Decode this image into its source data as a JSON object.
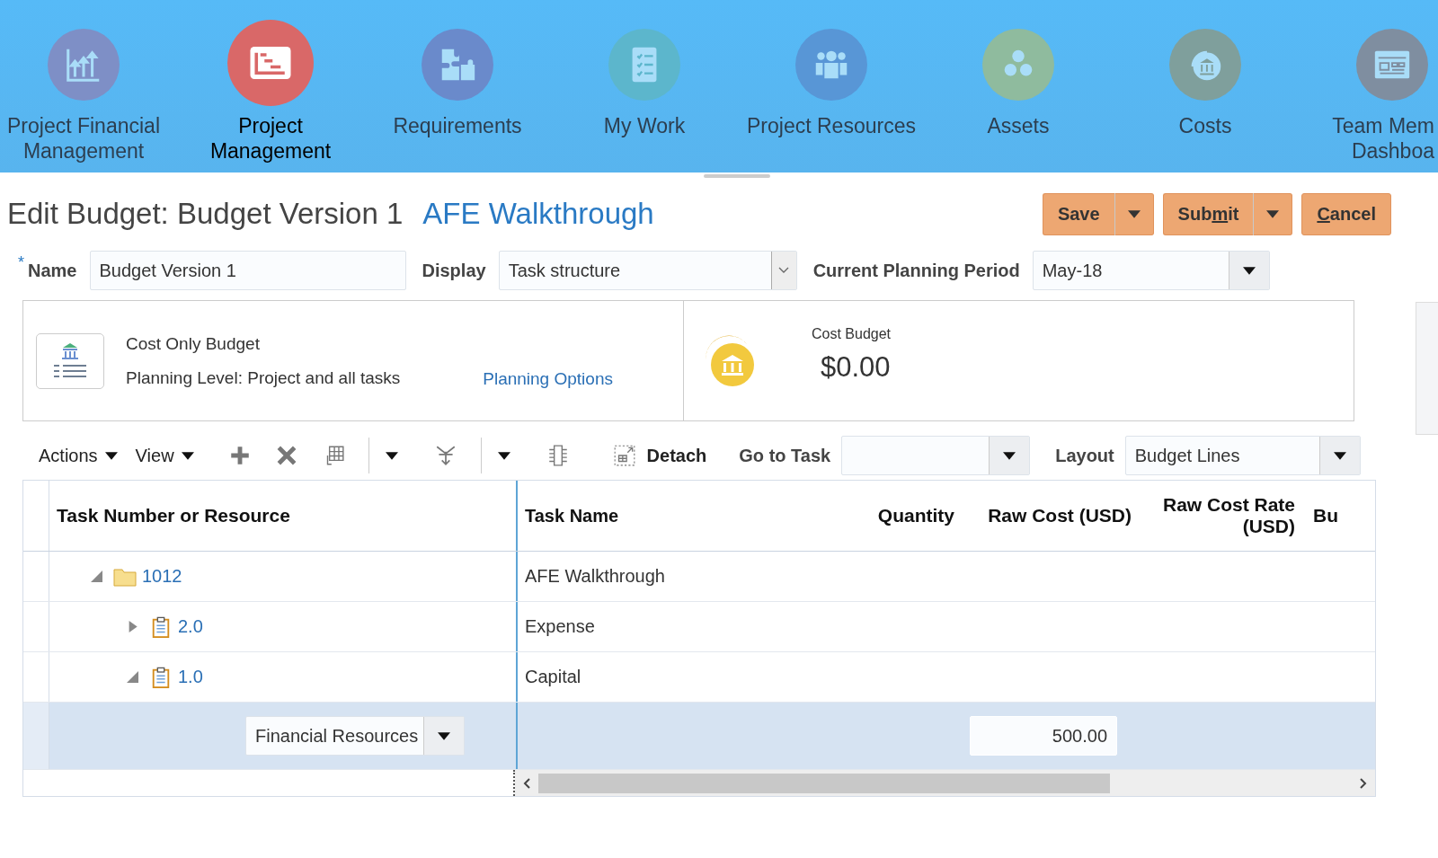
{
  "nav": [
    {
      "label_lines": [
        "Project Financial",
        "Management"
      ],
      "color": "#7e8fc6",
      "selected": false
    },
    {
      "label_lines": [
        "Project",
        "Management"
      ],
      "color": "#d96868",
      "selected": true
    },
    {
      "label_lines": [
        "Requirements"
      ],
      "color": "#6a8acb",
      "selected": false
    },
    {
      "label_lines": [
        "My Work"
      ],
      "color": "#5cb6cc",
      "selected": false
    },
    {
      "label_lines": [
        "Project Resources"
      ],
      "color": "#5896d6",
      "selected": false
    },
    {
      "label_lines": [
        "Assets"
      ],
      "color": "#8fbb9e",
      "selected": false
    },
    {
      "label_lines": [
        "Costs"
      ],
      "color": "#7f9f9c",
      "selected": false
    },
    {
      "label_lines": [
        "Team Mem",
        "Dashboa"
      ],
      "color": "#7f8ea0",
      "selected": false
    }
  ],
  "page": {
    "title": "Edit Budget: Budget Version 1",
    "project_link": "AFE Walkthrough"
  },
  "actions": [
    {
      "label_parts": [
        {
          "text": "Save",
          "underlined": false
        }
      ],
      "has_menu": true
    },
    {
      "label_parts": [
        {
          "text": "Sub",
          "underlined": false
        },
        {
          "text": "m",
          "underlined": true
        },
        {
          "text": "it",
          "underlined": false
        }
      ],
      "has_menu": true
    },
    {
      "label_parts": [
        {
          "text": "C",
          "underlined": true
        },
        {
          "text": "ancel",
          "underlined": false
        }
      ],
      "has_menu": false
    }
  ],
  "form": {
    "name": {
      "label": "Name",
      "required_mark": "*",
      "value": "Budget Version 1"
    },
    "display": {
      "label": "Display",
      "value": "Task structure"
    },
    "planning_period": {
      "label": "Current Planning Period",
      "value": "May-18"
    }
  },
  "summary": {
    "budget_type": "Cost Only Budget",
    "planning_level": "Planning Level: Project and all tasks",
    "planning_options_link": "Planning Options",
    "amount_label": "Cost Budget",
    "amount": "$0.00"
  },
  "toolbar": {
    "actions_menu": "Actions",
    "view_menu": "View",
    "detach": "Detach",
    "go_to_task": {
      "label": "Go to Task"
    },
    "layout": {
      "label": "Layout",
      "value": "Budget Lines"
    }
  },
  "table": {
    "columns": [
      "Task Number or Resource",
      "Task Name",
      "Quantity",
      "Raw Cost (USD)",
      "Raw Cost Rate (USD)",
      "Bu"
    ],
    "rows": [
      {
        "kind": "project",
        "number": "1012",
        "name": "AFE Walkthrough",
        "expanded": true,
        "selected": false,
        "children": [
          {
            "kind": "task",
            "number": "2.0",
            "name": "Expense",
            "expanded": false,
            "selected": false
          },
          {
            "kind": "task",
            "number": "1.0",
            "name": "Capital",
            "expanded": true,
            "selected": false,
            "children": [
              {
                "kind": "resource",
                "resource": "Financial Resources",
                "raw_cost": "500.00",
                "selected": true
              }
            ]
          }
        ]
      }
    ]
  }
}
